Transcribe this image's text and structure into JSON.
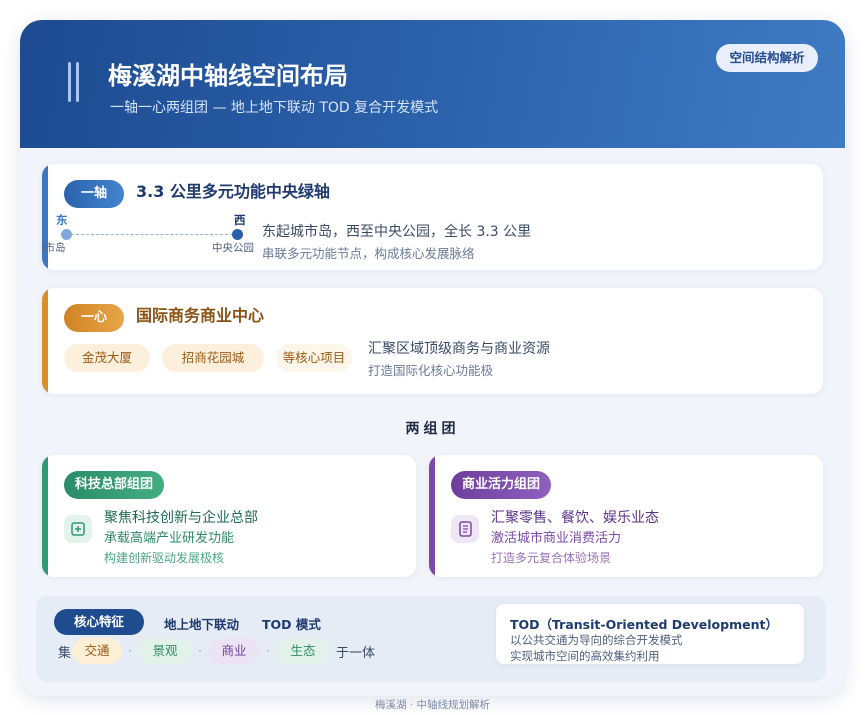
{
  "header": {
    "title": "梅溪湖中轴线空间布局",
    "subtitle": "一轴一心两组团 — 地上地下联动 TOD 复合开发模式",
    "badge": "空间结构解析"
  },
  "axis": {
    "tag": "一轴",
    "title": "3.3 公里多元功能中央绿轴",
    "east_label": "东",
    "west_label": "西",
    "east_place": "城市岛",
    "west_place": "中央公园",
    "line1": "东起城市岛，西至中央公园，全长 3.3 公里",
    "line2": "串联多元功能节点，构成核心发展脉络"
  },
  "core": {
    "tag": "一心",
    "title": "国际商务商业中心",
    "chips": [
      "金茂大厦",
      "招商花园城",
      "等核心项目"
    ],
    "line1": "汇聚区域顶级商务与商业资源",
    "line2": "打造国际化核心功能极"
  },
  "clusters": {
    "title": "两组团",
    "tech": {
      "tag": "科技总部组团",
      "icon": "plus-square-icon",
      "line1": "聚焦科技创新与企业总部",
      "line2": "承载高端产业研发功能",
      "line3": "构建创新驱动发展极核"
    },
    "commerce": {
      "tag": "商业活力组团",
      "icon": "document-icon",
      "line1": "汇聚零售、餐饮、娱乐业态",
      "line2": "激活城市商业消费活力",
      "line3": "打造多元复合体验场景"
    }
  },
  "features": {
    "tag": "核心特征",
    "item1": "地上地下联动",
    "item2": "TOD 模式",
    "prefix": "集",
    "keywords": [
      "交通",
      "景观",
      "商业",
      "生态"
    ],
    "separator": "·",
    "suffix": "于一体"
  },
  "tod": {
    "title": "TOD（Transit-Oriented Development）",
    "line1": "以公共交通为导向的综合开发模式",
    "line2": "实现城市空间的高效集约利用"
  },
  "credit": "梅溪湖 · 中轴线规划解析",
  "colors": {
    "header": "#2d64ae",
    "axis_accent": "#3b78c4",
    "core_accent": "#d98f2a",
    "tech_accent": "#2f9a73",
    "commerce_accent": "#7a4aa6"
  }
}
